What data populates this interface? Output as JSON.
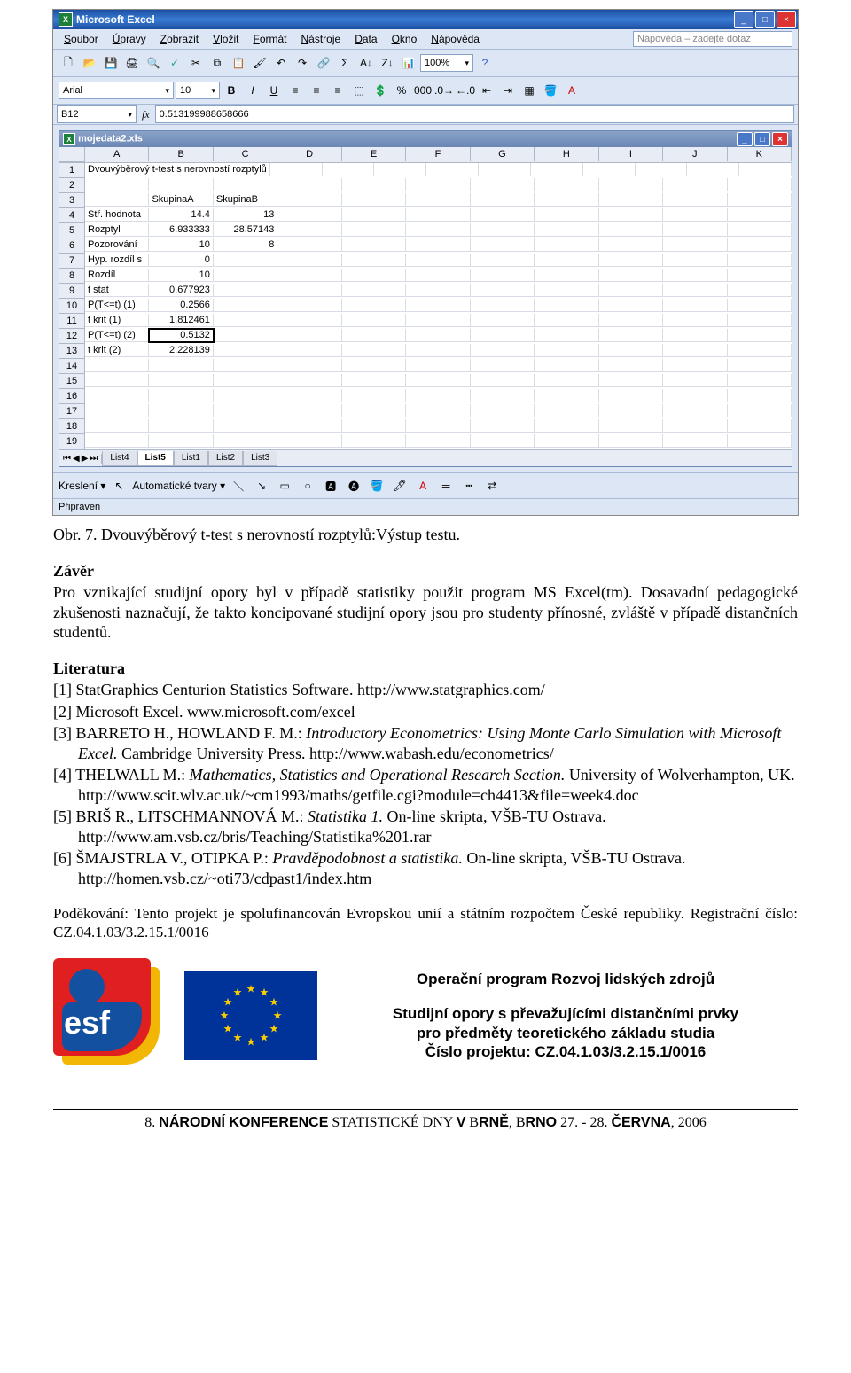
{
  "excel": {
    "app_name": "Microsoft Excel",
    "menus": [
      "Soubor",
      "Úpravy",
      "Zobrazit",
      "Vložit",
      "Formát",
      "Nástroje",
      "Data",
      "Okno",
      "Nápověda"
    ],
    "help_placeholder": "Nápověda – zadejte dotaz",
    "font_name": "Arial",
    "font_size": "10",
    "zoom": "100%",
    "name_box": "B12",
    "formula_bar": "0.513199988658666",
    "doc_title": "mojedata2.xls",
    "cols": [
      "A",
      "B",
      "C",
      "D",
      "E",
      "F",
      "G",
      "H",
      "I",
      "J",
      "K"
    ],
    "rows": [
      {
        "n": "1",
        "cells": [
          "Dvouvýběrový t-test s nerovností rozptylů",
          "",
          "",
          "",
          "",
          "",
          "",
          "",
          "",
          "",
          ""
        ]
      },
      {
        "n": "2",
        "cells": [
          "",
          "",
          "",
          "",
          "",
          "",
          "",
          "",
          "",
          "",
          ""
        ]
      },
      {
        "n": "3",
        "cells": [
          "",
          "SkupinaA",
          "SkupinaB",
          "",
          "",
          "",
          "",
          "",
          "",
          "",
          ""
        ]
      },
      {
        "n": "4",
        "cells": [
          "Stř. hodnota",
          "14.4",
          "13",
          "",
          "",
          "",
          "",
          "",
          "",
          "",
          ""
        ]
      },
      {
        "n": "5",
        "cells": [
          "Rozptyl",
          "6.933333",
          "28.57143",
          "",
          "",
          "",
          "",
          "",
          "",
          "",
          ""
        ]
      },
      {
        "n": "6",
        "cells": [
          "Pozorování",
          "10",
          "8",
          "",
          "",
          "",
          "",
          "",
          "",
          "",
          ""
        ]
      },
      {
        "n": "7",
        "cells": [
          "Hyp. rozdíl s",
          "0",
          "",
          "",
          "",
          "",
          "",
          "",
          "",
          "",
          ""
        ]
      },
      {
        "n": "8",
        "cells": [
          "Rozdíl",
          "10",
          "",
          "",
          "",
          "",
          "",
          "",
          "",
          "",
          ""
        ]
      },
      {
        "n": "9",
        "cells": [
          "t stat",
          "0.677923",
          "",
          "",
          "",
          "",
          "",
          "",
          "",
          "",
          ""
        ]
      },
      {
        "n": "10",
        "cells": [
          "P(T<=t) (1)",
          "0.2566",
          "",
          "",
          "",
          "",
          "",
          "",
          "",
          "",
          ""
        ]
      },
      {
        "n": "11",
        "cells": [
          "t krit (1)",
          "1.812461",
          "",
          "",
          "",
          "",
          "",
          "",
          "",
          "",
          ""
        ]
      },
      {
        "n": "12",
        "cells": [
          "P(T<=t) (2)",
          "0.5132",
          "",
          "",
          "",
          "",
          "",
          "",
          "",
          "",
          ""
        ]
      },
      {
        "n": "13",
        "cells": [
          "t krit (2)",
          "2.228139",
          "",
          "",
          "",
          "",
          "",
          "",
          "",
          "",
          ""
        ]
      },
      {
        "n": "14",
        "cells": [
          "",
          "",
          "",
          "",
          "",
          "",
          "",
          "",
          "",
          "",
          ""
        ]
      },
      {
        "n": "15",
        "cells": [
          "",
          "",
          "",
          "",
          "",
          "",
          "",
          "",
          "",
          "",
          ""
        ]
      },
      {
        "n": "16",
        "cells": [
          "",
          "",
          "",
          "",
          "",
          "",
          "",
          "",
          "",
          "",
          ""
        ]
      },
      {
        "n": "17",
        "cells": [
          "",
          "",
          "",
          "",
          "",
          "",
          "",
          "",
          "",
          "",
          ""
        ]
      },
      {
        "n": "18",
        "cells": [
          "",
          "",
          "",
          "",
          "",
          "",
          "",
          "",
          "",
          "",
          ""
        ]
      },
      {
        "n": "19",
        "cells": [
          "",
          "",
          "",
          "",
          "",
          "",
          "",
          "",
          "",
          "",
          ""
        ]
      }
    ],
    "sheet_tabs": [
      "List4",
      "List5",
      "List1",
      "List2",
      "List3"
    ],
    "active_sheet": "List5",
    "drawing_label": "Kreslení",
    "autoshapes": "Automatické tvary",
    "status": "Připraven"
  },
  "caption": "Obr. 7. Dvouvýběrový t-test s nerovností rozptylů:Výstup testu.",
  "zaver": {
    "heading": "Závěr",
    "text": "Pro vznikající studijní opory byl v případě statistiky použit program MS Excel(tm). Dosavadní pedagogické zkušenosti naznačují, že takto koncipované studijní opory jsou pro studenty přínosné, zvláště v případě distančních studentů."
  },
  "lit_heading": "Literatura",
  "refs": [
    {
      "n": "[1]",
      "text": "StatGraphics Centurion Statistics Software. http://www.statgraphics.com/"
    },
    {
      "n": "[2]",
      "text": "Microsoft Excel. www.microsoft.com/excel"
    },
    {
      "n": "[3]",
      "text": "BARRETO H., HOWLAND F. M.: <em>Introductory Econometrics: Using Monte Carlo Simulation with Microsoft Excel.</em> Cambridge University Press. http://www.wabash.edu/econometrics/"
    },
    {
      "n": "[4]",
      "text": "THELWALL M.: <em>Mathematics, Statistics and Operational Research Section.</em> University of Wolverhampton, UK. http://www.scit.wlv.ac.uk/~cm1993/maths/getfile.cgi?module=ch4413&file=week4.doc"
    },
    {
      "n": "[5]",
      "text": "BRIŠ R., LITSCHMANNOVÁ M.: <em>Statistika 1.</em> On-line skripta, VŠB-TU Ostrava. http://www.am.vsb.cz/bris/Teaching/Statistika%201.rar"
    },
    {
      "n": "[6]",
      "text": "ŠMAJSTRLA V., OTIPKA P.: <em>Pravděpodobnost a statistika.</em> On-line skripta, VŠB-TU Ostrava. http://homen.vsb.cz/~oti73/cdpast1/index.htm"
    }
  ],
  "ack": "Poděkování: Tento projekt je spolufinancován Evropskou unií a státním rozpočtem České republiky. Registrační číslo: CZ.04.1.03/3.2.15.1/0016",
  "program": {
    "title": "Operační program Rozvoj lidských zdrojů",
    "line1": "Studijní opory s převažujícími distančními prvky",
    "line2": "pro předměty teoretického základu studia",
    "line3": "Číslo projektu: CZ.04.1.03/3.2.15.1/0016"
  },
  "footer": "8. NÁRODNÍ KONFERENCE STATISTICKÉ DNY V BRNĚ, BRNO 27. - 28. ČERVNA, 2006"
}
